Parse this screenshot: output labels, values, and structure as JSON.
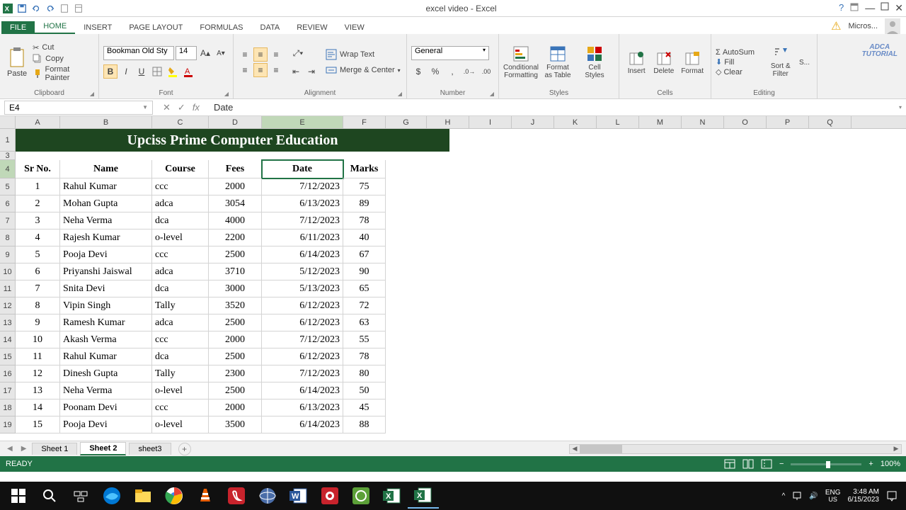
{
  "window": {
    "title": "excel video - Excel"
  },
  "qat": {
    "save": "save-icon",
    "undo": "undo-icon",
    "redo": "redo-icon",
    "new": "new-icon",
    "print": "print-icon"
  },
  "tabs": {
    "file": "FILE",
    "items": [
      "HOME",
      "INSERT",
      "PAGE LAYOUT",
      "FORMULAS",
      "DATA",
      "REVIEW",
      "VIEW"
    ],
    "active": "HOME",
    "account": "Micros..."
  },
  "ribbon": {
    "clipboard": {
      "label": "Clipboard",
      "paste": "Paste",
      "cut": "Cut",
      "copy": "Copy",
      "format_painter": "Format Painter"
    },
    "font": {
      "label": "Font",
      "name": "Bookman Old Sty",
      "size": "14"
    },
    "alignment": {
      "label": "Alignment",
      "wrap": "Wrap Text",
      "merge": "Merge & Center"
    },
    "number": {
      "label": "Number",
      "format": "General"
    },
    "styles": {
      "label": "Styles",
      "cond": "Conditional Formatting",
      "table": "Format as Table",
      "cell": "Cell Styles"
    },
    "cells": {
      "label": "Cells",
      "insert": "Insert",
      "delete": "Delete",
      "format": "Format"
    },
    "editing": {
      "label": "Editing",
      "sum": "AutoSum",
      "fill": "Fill",
      "clear": "Clear",
      "sort": "Sort & Filter",
      "find": "S..."
    }
  },
  "formula_bar": {
    "namebox": "E4",
    "fx_value": "Date"
  },
  "sheet": {
    "columns": [
      "A",
      "B",
      "C",
      "D",
      "E",
      "F",
      "G",
      "H",
      "I",
      "J",
      "K",
      "L",
      "M",
      "N",
      "O",
      "P",
      "Q"
    ],
    "active_col": "E",
    "active_row": 4,
    "banner": "Upciss Prime Computer Education",
    "headers": {
      "sr": "Sr No.",
      "name": "Name",
      "course": "Course",
      "fees": "Fees",
      "date": "Date",
      "marks": "Marks"
    },
    "rows": [
      {
        "sr": "1",
        "name": "Rahul Kumar",
        "course": "ccc",
        "fees": "2000",
        "date": "7/12/2023",
        "marks": "75"
      },
      {
        "sr": "2",
        "name": "Mohan Gupta",
        "course": "adca",
        "fees": "3054",
        "date": "6/13/2023",
        "marks": "89"
      },
      {
        "sr": "3",
        "name": "Neha Verma",
        "course": "dca",
        "fees": "4000",
        "date": "7/12/2023",
        "marks": "78"
      },
      {
        "sr": "4",
        "name": "Rajesh Kumar",
        "course": "o-level",
        "fees": "2200",
        "date": "6/11/2023",
        "marks": "40"
      },
      {
        "sr": "5",
        "name": "Pooja Devi",
        "course": "ccc",
        "fees": "2500",
        "date": "6/14/2023",
        "marks": "67"
      },
      {
        "sr": "6",
        "name": "Priyanshi Jaiswal",
        "course": "adca",
        "fees": "3710",
        "date": "5/12/2023",
        "marks": "90"
      },
      {
        "sr": "7",
        "name": "Snita Devi",
        "course": "dca",
        "fees": "3000",
        "date": "5/13/2023",
        "marks": "65"
      },
      {
        "sr": "8",
        "name": "Vipin Singh",
        "course": "Tally",
        "fees": "3520",
        "date": "6/12/2023",
        "marks": "72"
      },
      {
        "sr": "9",
        "name": "Ramesh Kumar",
        "course": "adca",
        "fees": "2500",
        "date": "6/12/2023",
        "marks": "63"
      },
      {
        "sr": "10",
        "name": "Akash Verma",
        "course": "ccc",
        "fees": "2000",
        "date": "7/12/2023",
        "marks": "55"
      },
      {
        "sr": "11",
        "name": "Rahul Kumar",
        "course": "dca",
        "fees": "2500",
        "date": "6/12/2023",
        "marks": "78"
      },
      {
        "sr": "12",
        "name": "Dinesh Gupta",
        "course": "Tally",
        "fees": "2300",
        "date": "7/12/2023",
        "marks": "80"
      },
      {
        "sr": "13",
        "name": "Neha Verma",
        "course": "o-level",
        "fees": "2500",
        "date": "6/14/2023",
        "marks": "50"
      },
      {
        "sr": "14",
        "name": "Poonam Devi",
        "course": "ccc",
        "fees": "2000",
        "date": "6/13/2023",
        "marks": "45"
      },
      {
        "sr": "15",
        "name": "Pooja Devi",
        "course": "o-level",
        "fees": "3500",
        "date": "6/14/2023",
        "marks": "88"
      }
    ]
  },
  "sheet_tabs": {
    "items": [
      "Sheet 1",
      "Sheet 2",
      "sheet3"
    ],
    "active": "Sheet 2"
  },
  "status": {
    "ready": "READY",
    "zoom": "100%"
  },
  "taskbar": {
    "lang": "ENG",
    "region": "US",
    "time": "3:48 AM",
    "date": "6/15/2023"
  },
  "watermark": {
    "l1": "ADCA",
    "l2": "TUTORIAL"
  }
}
